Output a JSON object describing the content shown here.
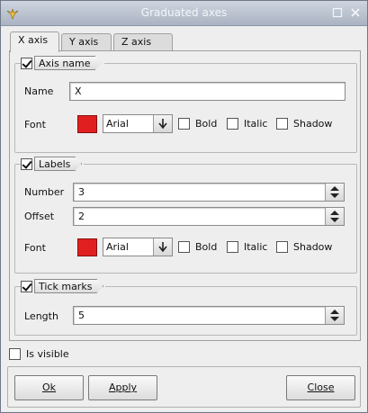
{
  "window": {
    "title": "Graduated axes"
  },
  "tabs": [
    {
      "label": "X axis"
    },
    {
      "label": "Y axis"
    },
    {
      "label": "Z axis"
    }
  ],
  "axis_name": {
    "title": "Axis name",
    "name_label": "Name",
    "name_value": "X",
    "font_label": "Font",
    "font_value": "Arial",
    "color": "#e02020",
    "bold": "Bold",
    "italic": "Italic",
    "shadow": "Shadow"
  },
  "labels": {
    "title": "Labels",
    "number_label": "Number",
    "number_value": "3",
    "offset_label": "Offset",
    "offset_value": "2",
    "font_label": "Font",
    "font_value": "Arial",
    "color": "#e02020",
    "bold": "Bold",
    "italic": "Italic",
    "shadow": "Shadow"
  },
  "tick_marks": {
    "title": "Tick marks",
    "length_label": "Length",
    "length_value": "5"
  },
  "is_visible": "Is visible",
  "buttons": {
    "ok": "Ok",
    "apply": "Apply",
    "close": "Close"
  },
  "icons": {
    "app": "bird-icon",
    "minimize": "minimize-icon",
    "close": "close-icon",
    "spin": "spin-arrows-icon",
    "dropdown": "down-arrow-icon"
  }
}
